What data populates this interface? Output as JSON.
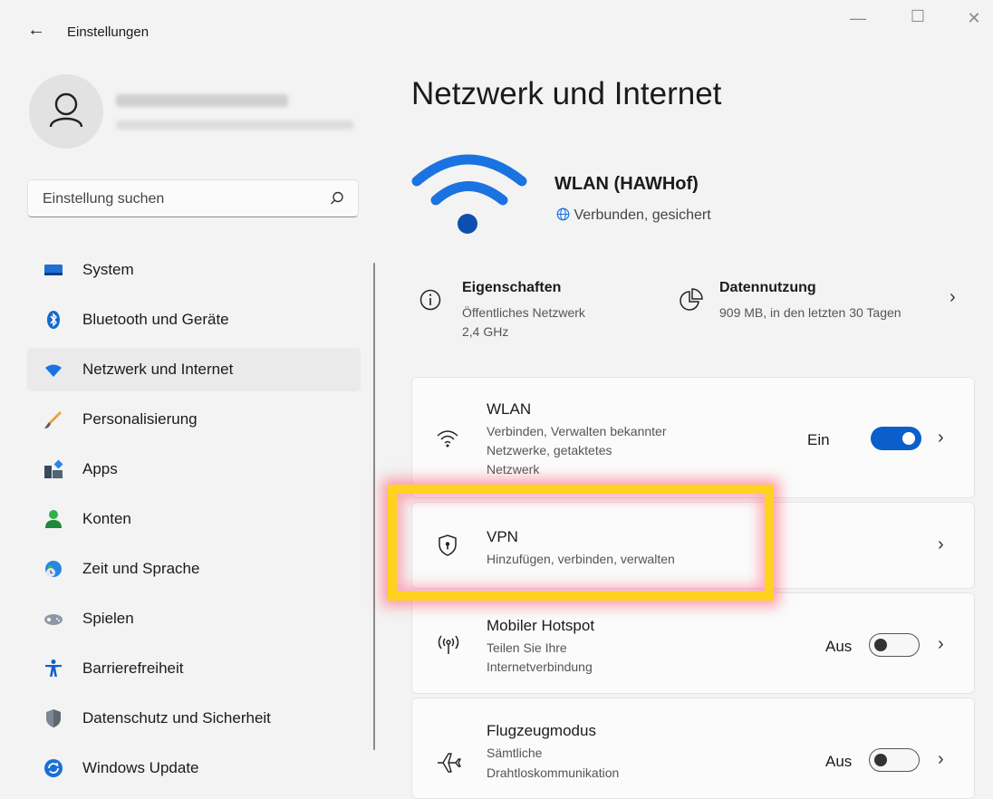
{
  "window": {
    "title": "Einstellungen",
    "back_glyph": "←",
    "minimize_glyph": "—",
    "maximize_glyph": "☐",
    "close_glyph": "✕"
  },
  "search": {
    "placeholder": "Einstellung suchen"
  },
  "sidebar": {
    "items": [
      {
        "label": "System",
        "icon": "monitor-icon",
        "active": false
      },
      {
        "label": "Bluetooth und Geräte",
        "icon": "bluetooth-icon",
        "active": false
      },
      {
        "label": "Netzwerk und Internet",
        "icon": "wifi-icon",
        "active": true
      },
      {
        "label": "Personalisierung",
        "icon": "brush-icon",
        "active": false
      },
      {
        "label": "Apps",
        "icon": "apps-icon",
        "active": false
      },
      {
        "label": "Konten",
        "icon": "person-icon",
        "active": false
      },
      {
        "label": "Zeit und Sprache",
        "icon": "globe-clock-icon",
        "active": false
      },
      {
        "label": "Spielen",
        "icon": "gamepad-icon",
        "active": false
      },
      {
        "label": "Barrierefreiheit",
        "icon": "accessibility-icon",
        "active": false
      },
      {
        "label": "Datenschutz und Sicherheit",
        "icon": "shield-icon",
        "active": false
      },
      {
        "label": "Windows Update",
        "icon": "update-icon",
        "active": false
      }
    ]
  },
  "main": {
    "title": "Netzwerk und Internet",
    "network": {
      "name": "WLAN (HAWHof)",
      "status": "Verbunden, gesichert"
    },
    "properties": {
      "title": "Eigenschaften",
      "line1": "Öffentliches Netzwerk",
      "line2": "2,4 GHz"
    },
    "data_usage": {
      "title": "Datennutzung",
      "line1": "909 MB, in den letzten 30 Tagen"
    },
    "cards": [
      {
        "title": "WLAN",
        "desc1": "Verbinden, Verwalten bekannter",
        "desc2": "Netzwerke, getaktetes",
        "desc3": "Netzwerk",
        "toggle_label": "Ein",
        "toggle_on": true
      },
      {
        "title": "VPN",
        "desc1": "Hinzufügen, verbinden, verwalten"
      },
      {
        "title": "Mobiler Hotspot",
        "desc1": "Teilen Sie Ihre",
        "desc2": "Internetverbindung",
        "toggle_label": "Aus",
        "toggle_on": false
      },
      {
        "title": "Flugzeugmodus",
        "desc1": "Sämtliche",
        "desc2": "Drahtloskommunikation",
        "toggle_label": "Aus",
        "toggle_on": false
      }
    ],
    "chevron": "›"
  },
  "colors": {
    "accent": "#0a5fcc",
    "highlight": "#ffd21f",
    "highlight_glow": "#ff506e"
  }
}
